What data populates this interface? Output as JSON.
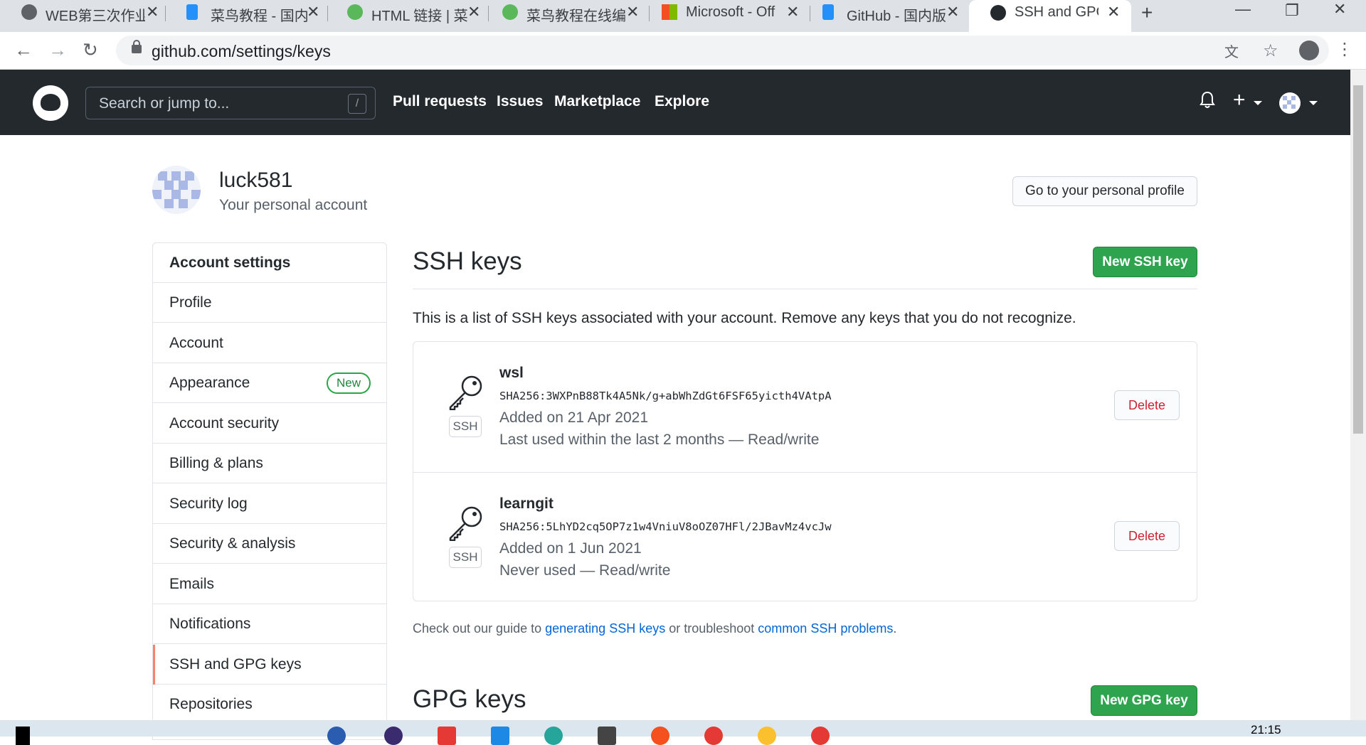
{
  "browser": {
    "tabs": [
      {
        "title": "WEB第三次作业",
        "icon": "globe-icon"
      },
      {
        "title": "菜鸟教程 - 国内",
        "icon": "bing-icon"
      },
      {
        "title": "HTML 链接 | 菜",
        "icon": "runoob-icon"
      },
      {
        "title": "菜鸟教程在线编",
        "icon": "runoob-icon"
      },
      {
        "title": "Microsoft - Off",
        "icon": "microsoft-icon"
      },
      {
        "title": "GitHub - 国内版",
        "icon": "bing-icon"
      },
      {
        "title": "SSH and GPG k",
        "icon": "github-icon",
        "active": true
      }
    ],
    "close_glyph": "✕",
    "new_tab_glyph": "+",
    "url": "github.com/settings/keys"
  },
  "header": {
    "search_placeholder": "Search or jump to...",
    "search_shortcut": "/",
    "nav": [
      "Pull requests",
      "Issues",
      "Marketplace",
      "Explore"
    ],
    "plus_glyph": "+"
  },
  "user": {
    "name": "luck581",
    "subtitle": "Your personal account",
    "profile_button": "Go to your personal profile"
  },
  "sidebar": {
    "items": [
      {
        "label": "Account settings"
      },
      {
        "label": "Profile"
      },
      {
        "label": "Account"
      },
      {
        "label": "Appearance",
        "badge": "New"
      },
      {
        "label": "Account security"
      },
      {
        "label": "Billing & plans"
      },
      {
        "label": "Security log"
      },
      {
        "label": "Security & analysis"
      },
      {
        "label": "Emails"
      },
      {
        "label": "Notifications"
      },
      {
        "label": "SSH and GPG keys",
        "selected": true
      },
      {
        "label": "Repositories"
      }
    ]
  },
  "ssh": {
    "title": "SSH keys",
    "new_button": "New SSH key",
    "description": "This is a list of SSH keys associated with your account. Remove any keys that you do not recognize.",
    "keys": [
      {
        "name": "wsl",
        "fingerprint": "SHA256:3WXPnB88Tk4A5Nk/g+abWhZdGt6FSF65yicth4VAtpA",
        "added": "Added on 21 Apr 2021",
        "last_used": "Last used within the last 2 months — Read/write",
        "type": "SSH",
        "delete": "Delete"
      },
      {
        "name": "learngit",
        "fingerprint": "SHA256:5LhYD2cq5OP7z1w4VniuV8oOZ07HFl/2JBavMz4vcJw",
        "added": "Added on 1 Jun 2021",
        "last_used": "Never used — Read/write",
        "type": "SSH",
        "delete": "Delete"
      }
    ],
    "guide_prefix": "Check out our guide to ",
    "guide_link1": "generating SSH keys",
    "guide_middle": " or troubleshoot ",
    "guide_link2": "common SSH problems",
    "guide_suffix": "."
  },
  "gpg": {
    "title": "GPG keys",
    "new_button": "New GPG key"
  },
  "taskbar": {
    "clock": "21:15"
  }
}
